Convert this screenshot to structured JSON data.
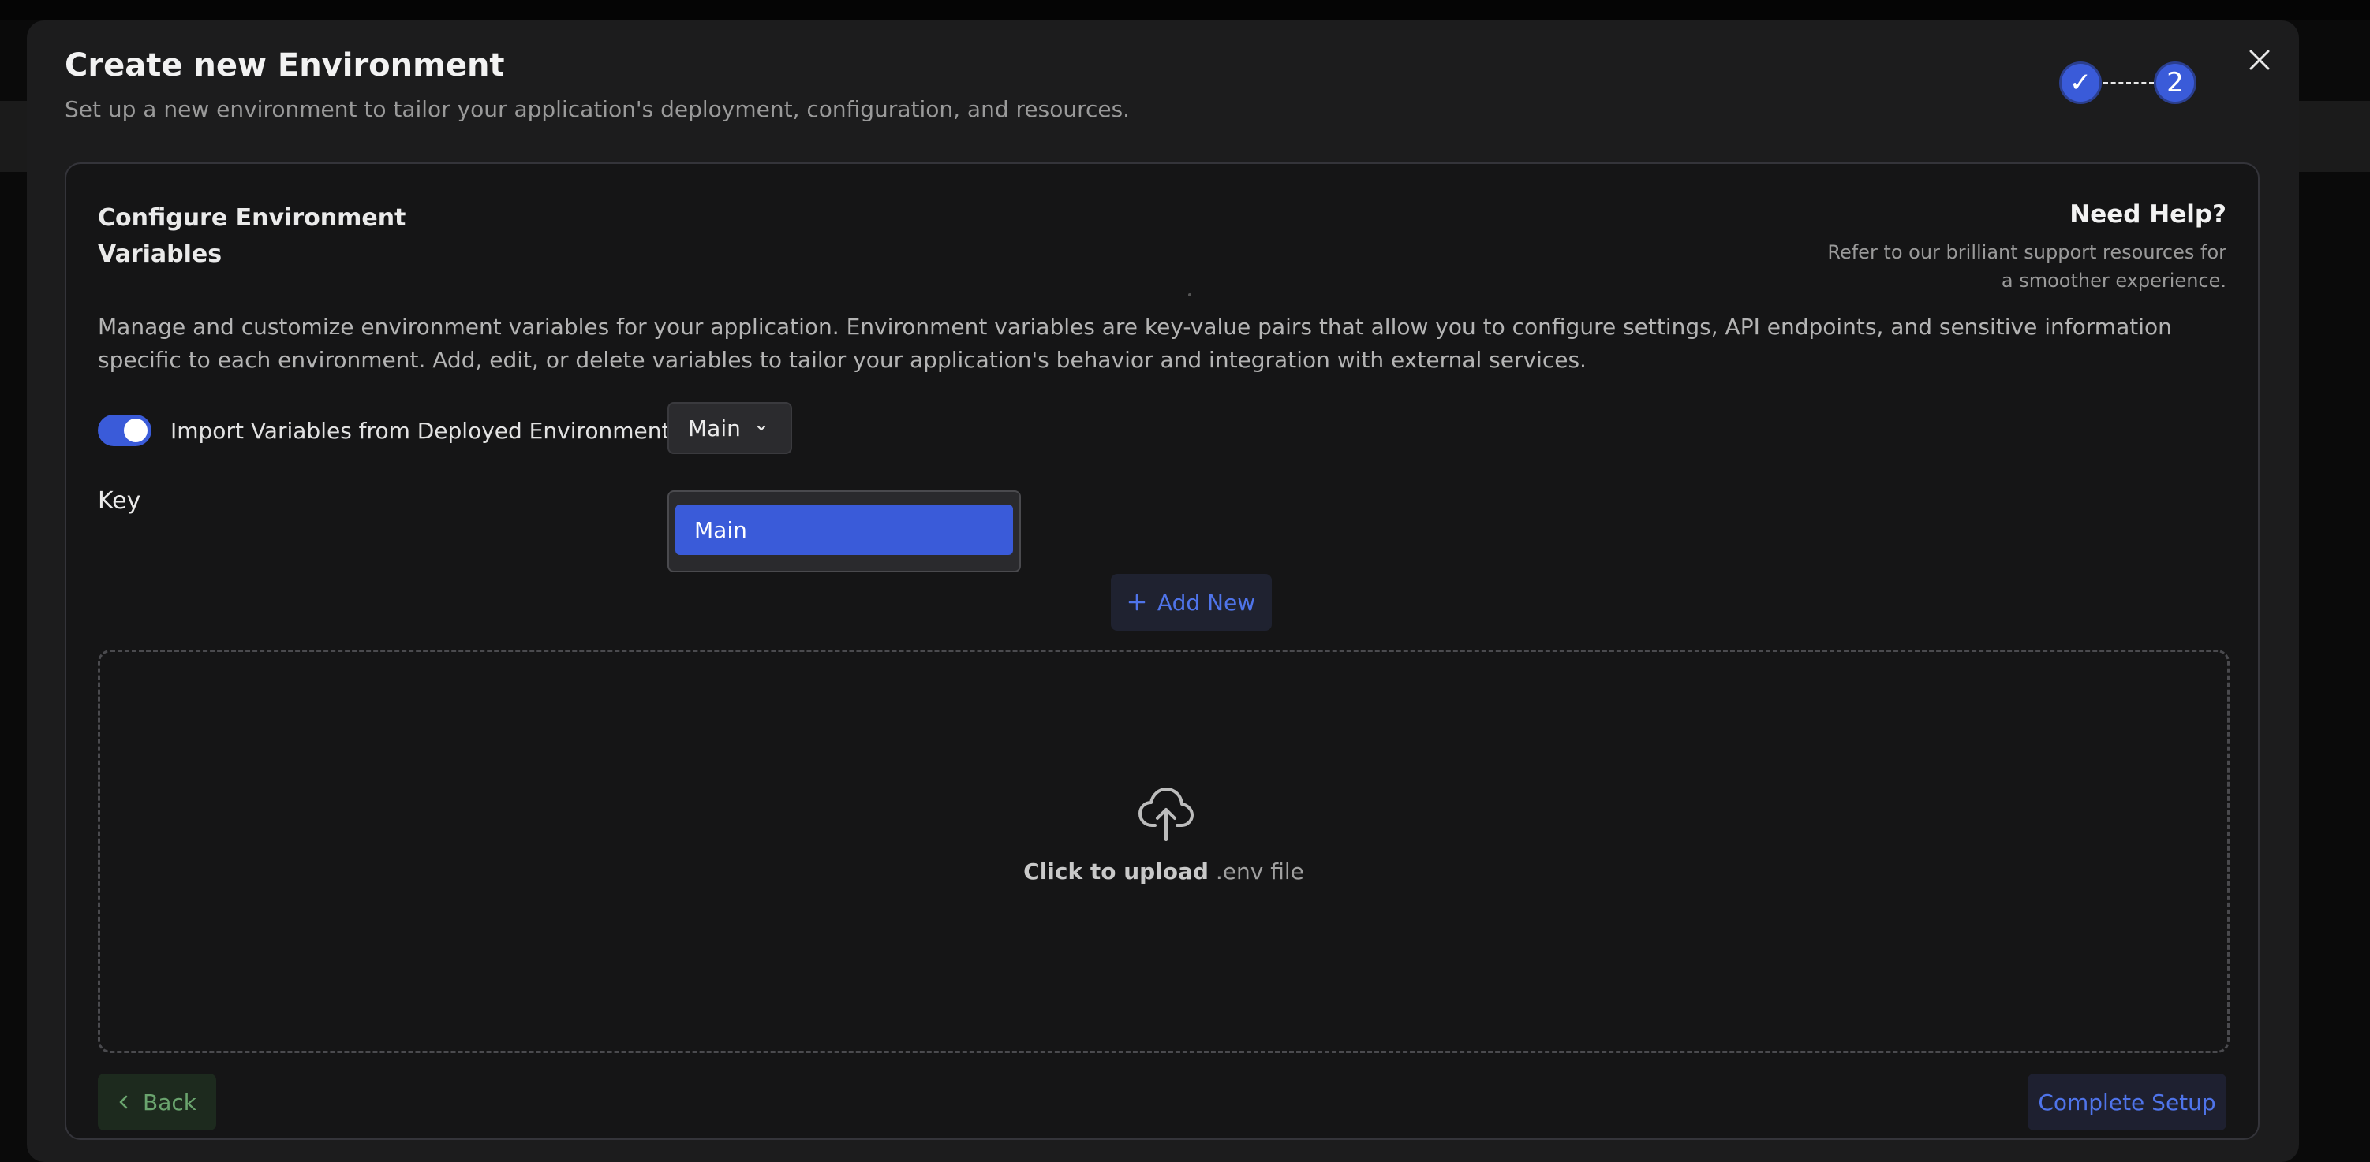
{
  "modal": {
    "title": "Create new Environment",
    "subtitle": "Set up a new environment to tailor your application's deployment, configuration, and resources.",
    "close_icon": "close-icon"
  },
  "stepper": {
    "step1": "✓",
    "step2": "2",
    "current_step": 2
  },
  "card": {
    "title": "Configure Environment Variables",
    "help_title": "Need Help?",
    "help_text": "Refer to our brilliant support resources for a smoother experience.",
    "description": "Manage and customize environment variables for your application. Environment variables are key-value pairs that allow you to configure settings, API endpoints, and sensitive information specific to each environment. Add, edit, or delete variables to tailor your application's behavior and integration with external services."
  },
  "import_toggle": {
    "label": "Import Variables from Deployed Environment",
    "enabled": true
  },
  "environment_select": {
    "value": "Main",
    "options": [
      "Main"
    ]
  },
  "table": {
    "key_header": "Key"
  },
  "add_new_label": "Add New",
  "upload": {
    "strong_text": "Click to upload",
    "rest_text": " .env file",
    "icon": "cloud-upload-icon"
  },
  "footer": {
    "back_label": "Back",
    "complete_label": "Complete Setup"
  },
  "colors": {
    "accent": "#3a5bd9",
    "link": "#4f74ea",
    "back_text": "#6aa46e",
    "background": "#1c1c1d"
  }
}
